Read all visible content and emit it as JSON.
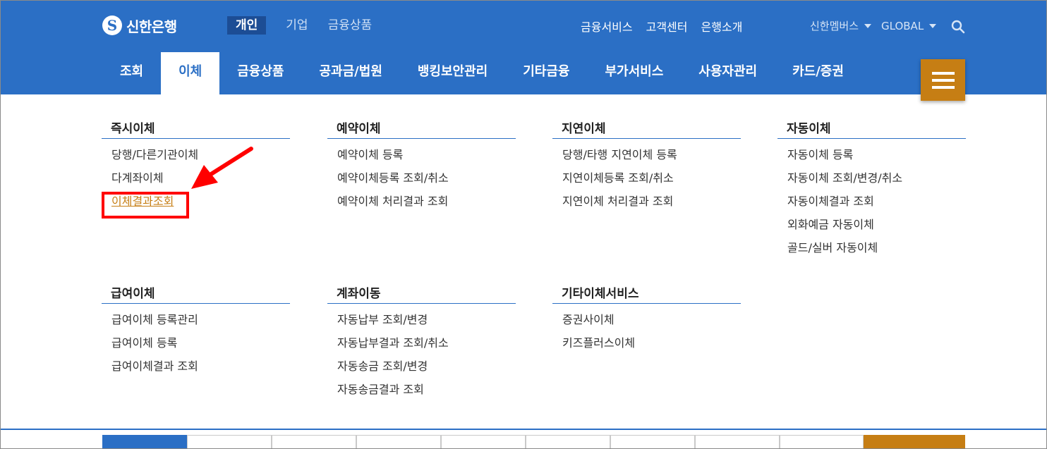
{
  "header": {
    "logo_text": "신한은행",
    "segments": [
      {
        "label": "개인",
        "active": true
      },
      {
        "label": "기업",
        "active": false
      },
      {
        "label": "금융상품",
        "active": false
      }
    ],
    "util_links": [
      "금융서비스",
      "고객센터",
      "은행소개"
    ],
    "members_label": "신한멤버스",
    "global_label": "GLOBAL"
  },
  "gnb": {
    "items": [
      {
        "label": "조회",
        "active": false
      },
      {
        "label": "이체",
        "active": true
      },
      {
        "label": "금융상품",
        "active": false
      },
      {
        "label": "공과금/법원",
        "active": false
      },
      {
        "label": "뱅킹보안관리",
        "active": false
      },
      {
        "label": "기타금융",
        "active": false
      },
      {
        "label": "부가서비스",
        "active": false
      },
      {
        "label": "사용자관리",
        "active": false
      },
      {
        "label": "카드/증권",
        "active": false
      }
    ]
  },
  "menu": {
    "groups": [
      {
        "title": "즉시이체",
        "items": [
          "당행/다른기관이체",
          "다계좌이체",
          "이체결과조회"
        ]
      },
      {
        "title": "예약이체",
        "items": [
          "예약이체 등록",
          "예약이체등록 조회/취소",
          "예약이체 처리결과 조회"
        ]
      },
      {
        "title": "지연이체",
        "items": [
          "당행/타행 지연이체 등록",
          "지연이체등록 조회/취소",
          "지연이체 처리결과 조회"
        ]
      },
      {
        "title": "자동이체",
        "items": [
          "자동이체 등록",
          "자동이체 조회/변경/취소",
          "자동이체결과 조회",
          "외화예금 자동이체",
          "골드/실버 자동이체"
        ]
      },
      {
        "title": "급여이체",
        "items": [
          "급여이체 등록관리",
          "급여이체 등록",
          "급여이체결과 조회"
        ]
      },
      {
        "title": "계좌이동",
        "items": [
          "자동납부 조회/변경",
          "자동납부결과 조회/취소",
          "자동송금 조회/변경",
          "자동송금결과 조회"
        ]
      },
      {
        "title": "기타이체서비스",
        "items": [
          "증권사이체",
          "키즈플러스이체"
        ]
      }
    ]
  },
  "colors": {
    "brand_blue": "#2b6fc5",
    "accent_orange": "#c67e14",
    "annotation_red": "#ff0000"
  }
}
